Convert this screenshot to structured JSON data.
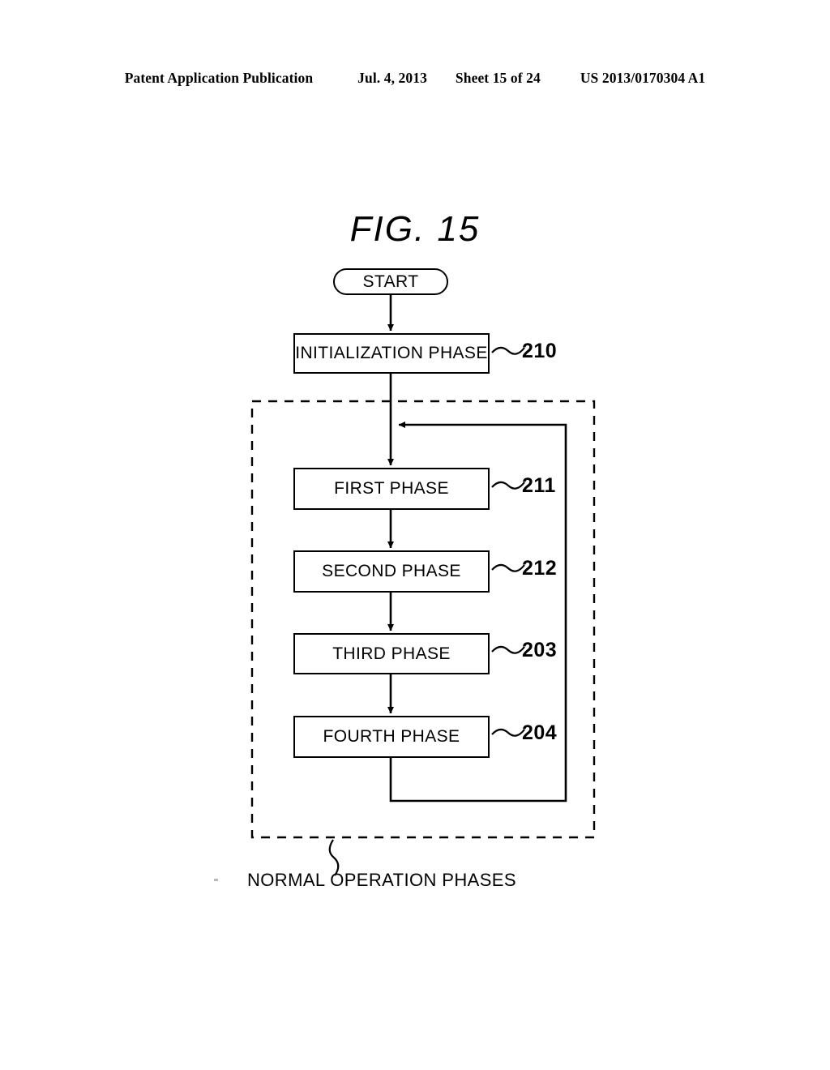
{
  "header": {
    "publication": "Patent Application Publication",
    "date": "Jul. 4, 2013",
    "sheet": "Sheet 15 of 24",
    "doc_number": "US 2013/0170304 A1"
  },
  "figure": {
    "title": "FIG.  15",
    "caption": "NORMAL OPERATION PHASES"
  },
  "nodes": {
    "start": {
      "label": "START",
      "shape": "stadium"
    },
    "initialization": {
      "label": "INITIALIZATION PHASE",
      "ref": "210"
    },
    "first": {
      "label": "FIRST PHASE",
      "ref": "211"
    },
    "second": {
      "label": "SECOND PHASE",
      "ref": "212"
    },
    "third": {
      "label": "THIRD PHASE",
      "ref": "203"
    },
    "fourth": {
      "label": "FOURTH PHASE",
      "ref": "204"
    }
  },
  "colors": {
    "ink": "#000000",
    "paper": "#ffffff"
  }
}
